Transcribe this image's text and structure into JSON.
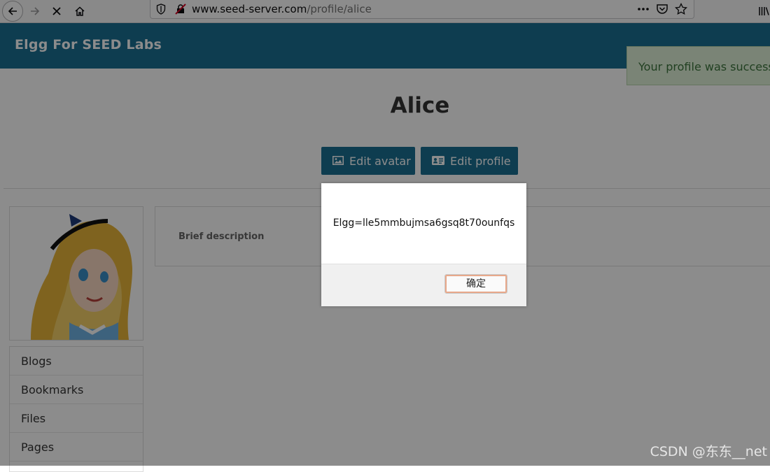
{
  "browser": {
    "url_domain": "www.seed-server.com",
    "url_path": "/profile/alice"
  },
  "site": {
    "title": "Elgg For SEED Labs",
    "flash_message": "Your profile was successfully saved."
  },
  "profile": {
    "name": "Alice",
    "edit_avatar_label": "Edit avatar",
    "edit_profile_label": "Edit profile",
    "brief_description_label": "Brief description"
  },
  "menu": {
    "items": [
      {
        "label": "Blogs"
      },
      {
        "label": "Bookmarks"
      },
      {
        "label": "Files"
      },
      {
        "label": "Pages"
      }
    ]
  },
  "dialog": {
    "message": "Elgg=lle5mmbujmsa6gsq8t70ounfqs",
    "ok_label": "确定"
  },
  "watermark": "CSDN @东东__net",
  "colors": {
    "header": "#1a6f93",
    "button": "#1a6f93",
    "flash_bg": "#dff0d8",
    "flash_text": "#3c763d"
  }
}
